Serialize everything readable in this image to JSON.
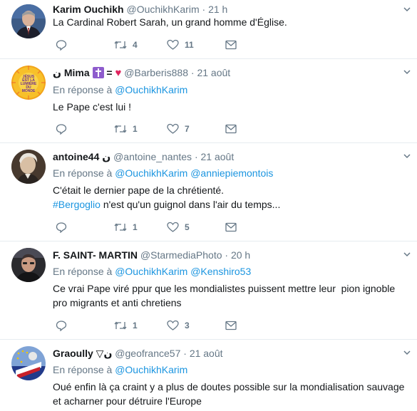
{
  "tweets": [
    {
      "name": "Karim Ouchikh",
      "handle": "@OuchikhKarim",
      "time": "21 h",
      "text": "La Cardinal Robert Sarah, un grand homme d'Église.",
      "retweets": "4",
      "likes": "11"
    },
    {
      "name": "ن Mima",
      "name_suffix_eq": "=",
      "handle": "@Barberis888",
      "time": "21 août",
      "reply_prefix": "En réponse à",
      "reply_to": "@OuchikhKarim",
      "avatar_text": "JÉSUS EST LA LUMIÈRE DU MONDE",
      "text": "Le Pape c'est lui !",
      "retweets": "1",
      "likes": "7"
    },
    {
      "name": "antoine44 ن",
      "handle": "@antoine_nantes",
      "time": "21 août",
      "reply_prefix": "En réponse à",
      "reply_to": "@OuchikhKarim @anniepiemontois",
      "text_line1": "C'était le dernier pape de la chrétienté.",
      "hashtag": "#Bergoglio",
      "text_line2_rest": " n'est qu'un guignol dans l'air du temps...",
      "retweets": "1",
      "likes": "5"
    },
    {
      "name": "F. SAINT- MARTIN",
      "handle": "@StarmediaPhoto",
      "time": "20 h",
      "reply_prefix": "En réponse à",
      "reply_to": "@OuchikhKarim @Kenshiro53",
      "text_line1": "Ce vrai Pape viré ppur que les mondialistes puissent mettre leur  pion ignoble",
      "text_line2": "pro migrants et anti chretiens",
      "retweets": "1",
      "likes": "3"
    },
    {
      "name": "Graoully ▽ن",
      "handle": "@geofrance57",
      "time": "21 août",
      "reply_prefix": "En réponse à",
      "reply_to": "@OuchikhKarim",
      "text_line1": "Oué enfin là ça craint y a plus de doutes possible sur la mondialisation sauvage",
      "text_line2": "et acharner pour détruire l'Europe"
    }
  ],
  "separator": "·",
  "colors": {
    "link": "#1b95e0",
    "secondary": "#657786",
    "border": "#e6ecf0"
  }
}
